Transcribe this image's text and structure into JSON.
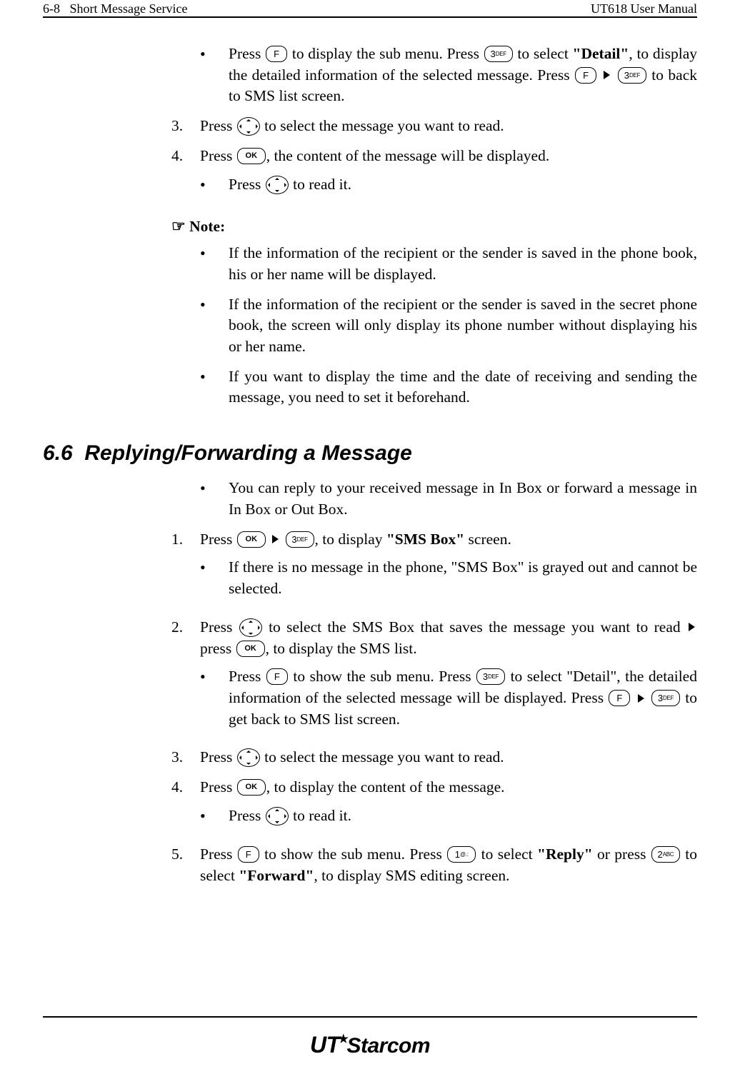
{
  "header": {
    "left_page": "6-8",
    "left_title": "Short Message Service",
    "right_title": "UT618 User Manual"
  },
  "keys": {
    "f": "F",
    "three": "3",
    "three_sub": "DEF",
    "two": "2",
    "two_sub": "ABC",
    "one": "1",
    "one_sub": "@.:",
    "ok": "OK"
  },
  "body_top": {
    "b1_a": "Press ",
    "b1_b": " to display the sub menu. Press ",
    "b1_c": " to select ",
    "b1_detail": "\"Detail\"",
    "b1_d": ", to display the detailed information of the selected message. Press ",
    "b1_e": " to back to SMS list screen.",
    "step3_a": "Press ",
    "step3_b": " to select the message you want to read.",
    "step4_a": "Press ",
    "step4_b": ", the content of the message will be displayed.",
    "sub4_a": "Press ",
    "sub4_b": " to read it."
  },
  "note": {
    "label": "Note:",
    "n1": "If the information of the recipient or the sender is saved in the phone book, his or her name will be displayed.",
    "n2": "If the information of the recipient or the sender is saved in the secret phone book, the screen will only display its phone number without displaying his or her name.",
    "n3": "If you want to display the time and the date of receiving and sending the message, you need to set it beforehand."
  },
  "section": {
    "number": "6.6",
    "title": "Replying/Forwarding a Message"
  },
  "body_bottom": {
    "intro": "You can reply to your received message in In Box or forward a message in In Box or Out Box.",
    "s1_a": "Press ",
    "s1_b": ", to display ",
    "s1_smsbox": "\"SMS Box\"",
    "s1_c": " screen.",
    "s1_sub": "If there is no message in the phone, \"SMS Box\" is grayed out and cannot be selected.",
    "s2_a": "Press ",
    "s2_b": " to select the SMS Box that saves the message you want to read ",
    "s2_c": " press ",
    "s2_d": ", to display the SMS list.",
    "s2_sub_a": "Press ",
    "s2_sub_b": " to show the sub menu. Press ",
    "s2_sub_c": " to select \"Detail\", the detailed information of the selected message will be displayed. Press ",
    "s2_sub_d": " to get back to SMS list screen.",
    "s3_a": "Press ",
    "s3_b": " to select the message you want to read.",
    "s4_a": "Press ",
    "s4_b": ", to display the content of the message.",
    "s4_sub_a": "Press ",
    "s4_sub_b": " to read it.",
    "s5_a": "Press ",
    "s5_b": " to show the sub menu. Press ",
    "s5_c": " to select ",
    "s5_reply": "\"Reply\"",
    "s5_d": " or press ",
    "s5_e": " to select ",
    "s5_forward": "\"Forward\"",
    "s5_f": ", to display SMS editing screen."
  },
  "footer": {
    "logo_a": "UT",
    "logo_b": "Starcom"
  }
}
